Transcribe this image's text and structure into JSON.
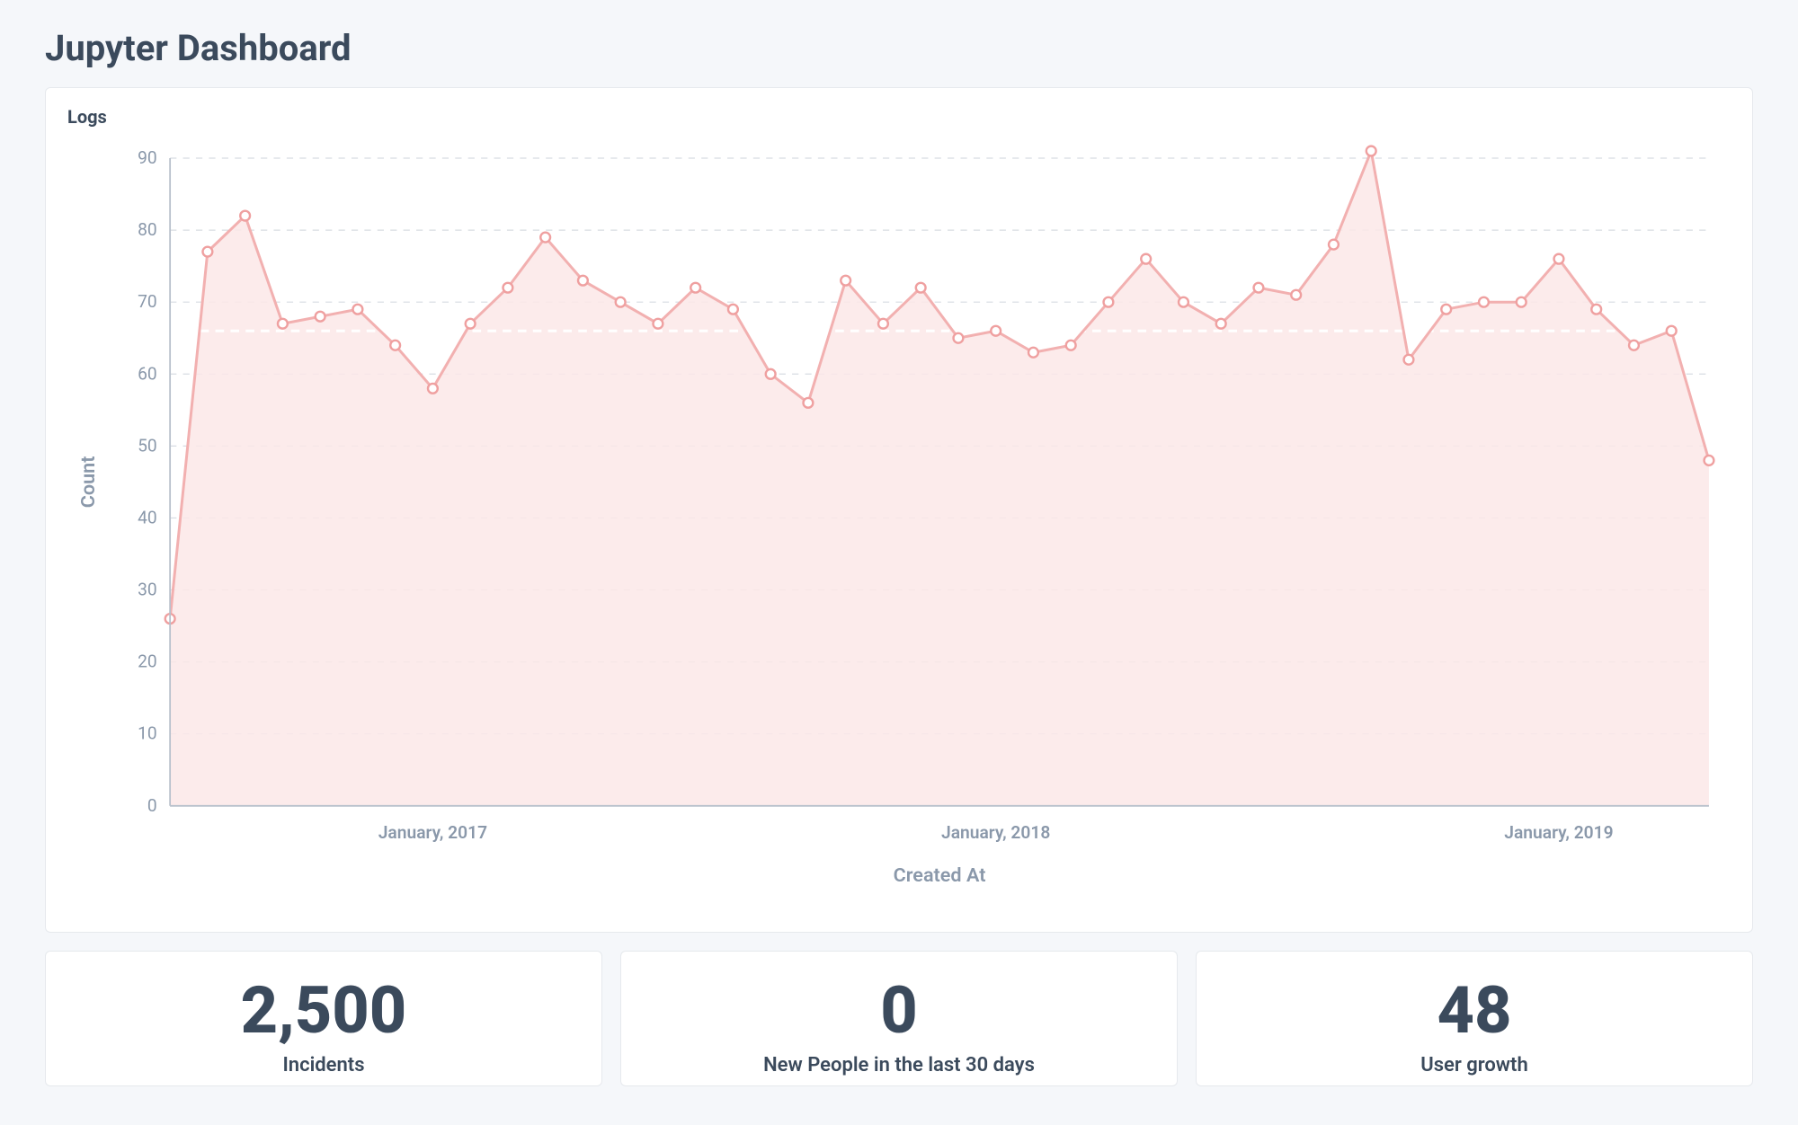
{
  "page": {
    "title": "Jupyter Dashboard"
  },
  "chart_card": {
    "title": "Logs"
  },
  "chart_data": {
    "type": "line",
    "title": "Logs",
    "xlabel": "Created At",
    "ylabel": "Count",
    "ylim": [
      0,
      90
    ],
    "yticks": [
      0,
      10,
      20,
      30,
      40,
      50,
      60,
      70,
      80,
      90
    ],
    "xticks": [
      "January, 2017",
      "January, 2018",
      "January, 2019"
    ],
    "xtick_positions": [
      7,
      22,
      37
    ],
    "trend_value": 66,
    "series": [
      {
        "name": "Count",
        "values": [
          26,
          77,
          82,
          67,
          68,
          69,
          64,
          58,
          67,
          72,
          79,
          73,
          70,
          67,
          72,
          69,
          60,
          56,
          73,
          67,
          72,
          65,
          66,
          63,
          64,
          70,
          76,
          70,
          67,
          72,
          71,
          78,
          91,
          62,
          69,
          70,
          70,
          76,
          69,
          64,
          66,
          48
        ]
      }
    ]
  },
  "stats": [
    {
      "value": "2,500",
      "label": "Incidents"
    },
    {
      "value": "0",
      "label": "New People in the last 30 days"
    },
    {
      "value": "48",
      "label": "User growth"
    }
  ]
}
